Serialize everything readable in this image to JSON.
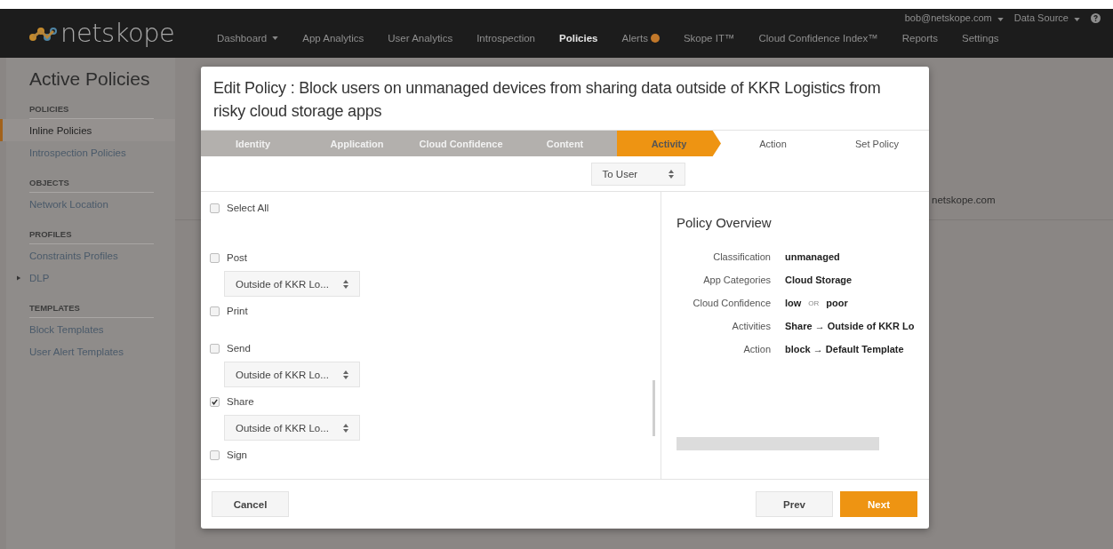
{
  "topbar": {
    "logo": "netskope",
    "nav": [
      {
        "label": "Dashboard",
        "selected": false,
        "caret": true
      },
      {
        "label": "App Analytics",
        "selected": false
      },
      {
        "label": "User Analytics",
        "selected": false
      },
      {
        "label": "Introspection",
        "selected": false
      },
      {
        "label": "Policies",
        "selected": true
      },
      {
        "label": "Alerts",
        "selected": false,
        "badge": true
      },
      {
        "label": "Skope IT™",
        "selected": false
      },
      {
        "label": "Cloud Confidence Index™",
        "selected": false
      },
      {
        "label": "Reports",
        "selected": false
      },
      {
        "label": "Settings",
        "selected": false
      }
    ],
    "user": "bob@netskope.com",
    "data_source": "Data Source"
  },
  "sidebar": {
    "title": "Active Policies",
    "sections": [
      {
        "heading": "POLICIES",
        "items": [
          {
            "label": "Inline Policies",
            "selected": true
          },
          {
            "label": "Introspection Policies",
            "selected": false
          }
        ]
      },
      {
        "heading": "OBJECTS",
        "items": [
          {
            "label": "Network Location",
            "selected": false
          }
        ]
      },
      {
        "heading": "PROFILES",
        "items": [
          {
            "label": "Constraints Profiles",
            "selected": false
          },
          {
            "label": "DLP",
            "selected": false,
            "expanded": false
          }
        ]
      },
      {
        "heading": "TEMPLATES",
        "items": [
          {
            "label": "Block Templates",
            "selected": false
          },
          {
            "label": "User Alert Templates",
            "selected": false
          }
        ]
      }
    ]
  },
  "background_text": "netskope.com",
  "modal": {
    "title": "Edit Policy : Block users on unmanaged devices from sharing data outside of KKR Logistics from risky cloud storage apps",
    "steps": [
      {
        "label": "Identity",
        "done": true,
        "selected": false
      },
      {
        "label": "Application",
        "done": true,
        "selected": false
      },
      {
        "label": "Cloud Confidence",
        "done": true,
        "selected": false
      },
      {
        "label": "Content",
        "done": true,
        "selected": false
      },
      {
        "label": "Activity",
        "done": false,
        "selected": true
      },
      {
        "label": "Action",
        "done": false,
        "selected": false
      },
      {
        "label": "Set Policy",
        "done": false,
        "selected": false
      }
    ],
    "direction": "To User",
    "activities": [
      {
        "label": "Select All",
        "checked": false
      },
      {
        "label": "Post",
        "checked": false,
        "target": "Outside of KKR Lo..."
      },
      {
        "label": "Print",
        "checked": false
      },
      {
        "label": "Send",
        "checked": false,
        "target": "Outside of KKR Lo..."
      },
      {
        "label": "Share",
        "checked": true,
        "target": "Outside of KKR Lo..."
      },
      {
        "label": "Sign",
        "checked": false
      }
    ],
    "overview": {
      "title": "Policy Overview",
      "rows": [
        {
          "label": "Classification",
          "parts": [
            {
              "text": "unmanaged",
              "kind": "value"
            }
          ]
        },
        {
          "label": "App Categories",
          "parts": [
            {
              "text": "Cloud Storage",
              "kind": "value"
            }
          ]
        },
        {
          "label": "Cloud Confidence",
          "parts": [
            {
              "text": "low",
              "kind": "value"
            },
            {
              "text": "OR",
              "kind": "op"
            },
            {
              "text": "poor",
              "kind": "value"
            }
          ]
        },
        {
          "label": "Activities",
          "parts": [
            {
              "text": "Share → Outside of KKR Lo",
              "kind": "value"
            }
          ]
        },
        {
          "label": "Action",
          "parts": [
            {
              "text": "block → Default Template",
              "kind": "value"
            }
          ]
        }
      ]
    },
    "buttons": [
      {
        "label": "Cancel",
        "kind": "secondary"
      },
      {
        "label": "Prev",
        "kind": "secondary"
      },
      {
        "label": "Next",
        "kind": "primary"
      }
    ]
  }
}
